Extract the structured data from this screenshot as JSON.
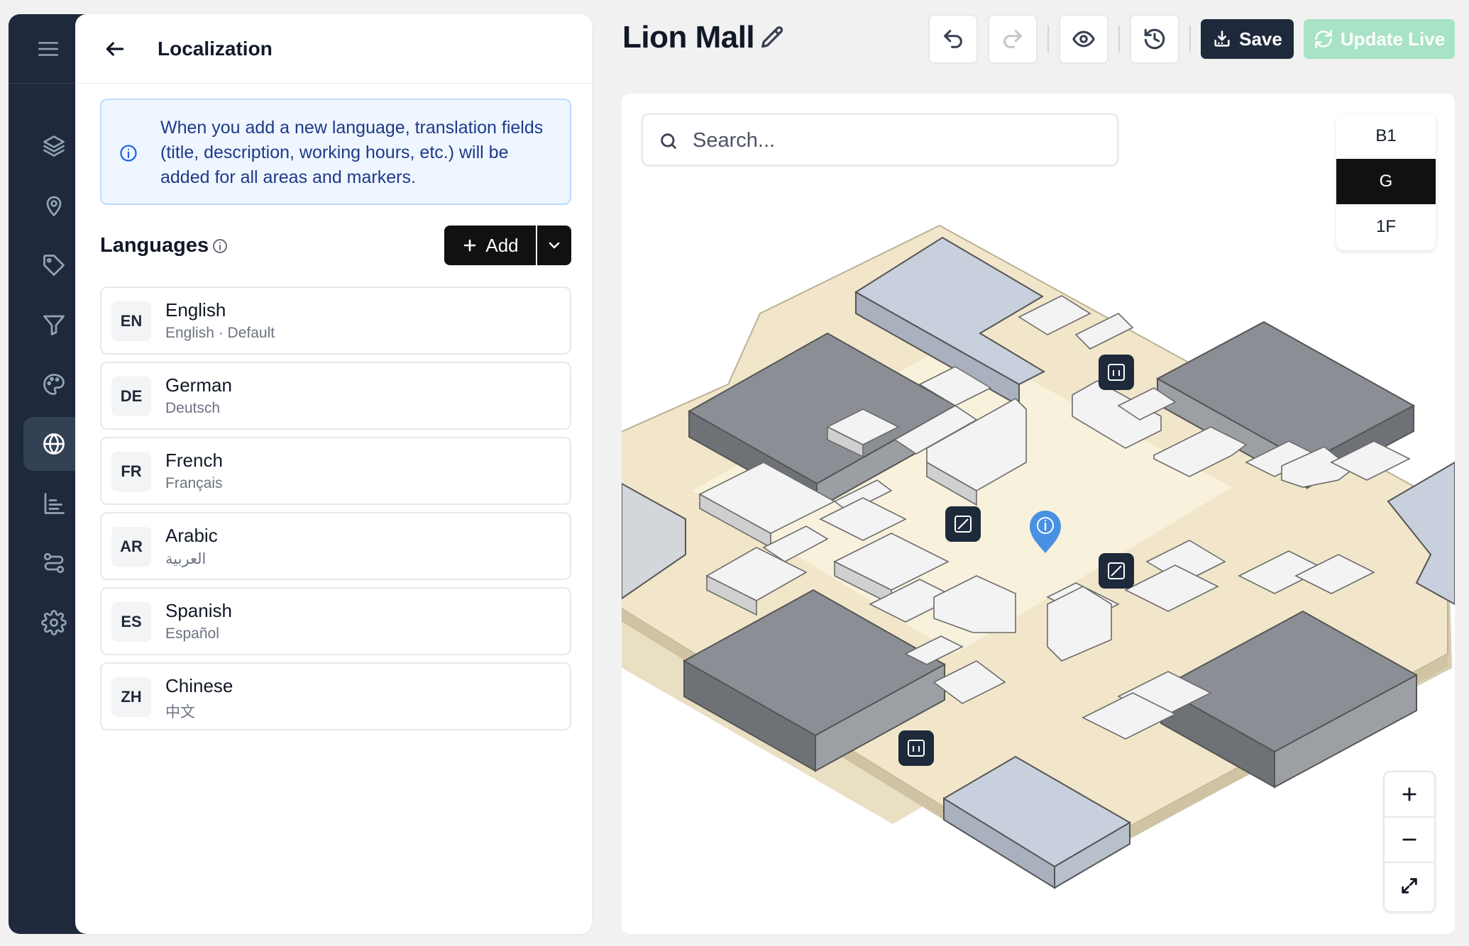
{
  "sidebar": {
    "items": [
      {
        "icon": "layers-icon"
      },
      {
        "icon": "map-pin-icon"
      },
      {
        "icon": "tag-icon"
      },
      {
        "icon": "filter-icon"
      },
      {
        "icon": "palette-icon"
      },
      {
        "icon": "globe-icon",
        "active": true
      },
      {
        "icon": "bar-chart-icon"
      },
      {
        "icon": "route-icon"
      },
      {
        "icon": "gear-icon"
      }
    ]
  },
  "panel": {
    "title": "Localization",
    "info_text": "When you add a new language, translation fields (title, description, working hours, etc.) will be added for all areas and markers.",
    "languages_label": "Languages",
    "add_label": "Add",
    "languages": [
      {
        "code": "EN",
        "name": "English",
        "sub": "English · Default"
      },
      {
        "code": "DE",
        "name": "German",
        "sub": "Deutsch"
      },
      {
        "code": "FR",
        "name": "French",
        "sub": "Français"
      },
      {
        "code": "AR",
        "name": "Arabic",
        "sub": "العربية"
      },
      {
        "code": "ES",
        "name": "Spanish",
        "sub": "Español"
      },
      {
        "code": "ZH",
        "name": "Chinese",
        "sub": "中文"
      }
    ]
  },
  "header": {
    "title": "Lion Mall",
    "save_label": "Save",
    "update_live_label": "Update Live"
  },
  "map": {
    "search_placeholder": "Search...",
    "floors": [
      "B1",
      "G",
      "1F"
    ],
    "active_floor": "G"
  },
  "colors": {
    "sidebar": "#1e293b",
    "accent_dark": "#111111",
    "save": "#1e293b",
    "update_live": "#a7e3c4",
    "info_bg": "#eff6ff",
    "map_floor": "#f1e6c9",
    "marker": "#4a90e2"
  }
}
